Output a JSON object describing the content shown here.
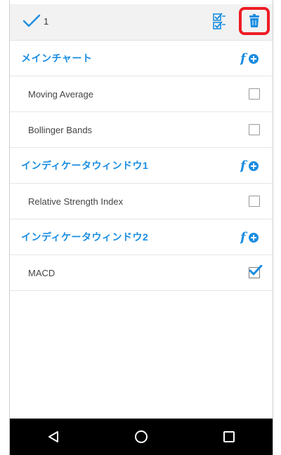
{
  "colors": {
    "accent": "#1a8de0",
    "highlight": "#ee1c25",
    "navbar": "#000000"
  },
  "toolbar": {
    "check_icon": "check-icon",
    "selected_count": "1",
    "select_all_icon": "checklist-icon",
    "delete_icon": "trash-icon"
  },
  "sections": [
    {
      "title": "メインチャート",
      "add_icon": "add-function-icon",
      "items": [
        {
          "label": "Moving Average",
          "checked": false
        },
        {
          "label": "Bollinger Bands",
          "checked": false
        }
      ]
    },
    {
      "title": "インディケータウィンドウ1",
      "add_icon": "add-function-icon",
      "items": [
        {
          "label": "Relative Strength Index",
          "checked": false
        }
      ]
    },
    {
      "title": "インディケータウィンドウ2",
      "add_icon": "add-function-icon",
      "items": [
        {
          "label": "MACD",
          "checked": true
        }
      ]
    }
  ],
  "navbar": {
    "back_icon": "back-icon",
    "home_icon": "home-icon",
    "recents_icon": "recents-icon"
  }
}
